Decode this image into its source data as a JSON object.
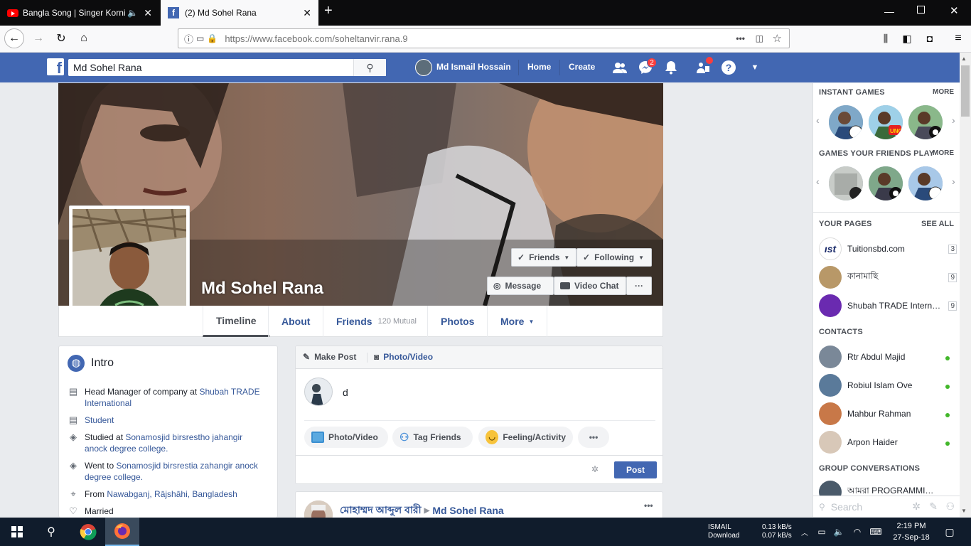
{
  "browser": {
    "tabs": [
      {
        "title": "Bangla Song | Singer Kornia"
      },
      {
        "title": "(2) Md Sohel Rana"
      }
    ],
    "url": "https://www.facebook.com/soheltanvir.rana.9",
    "url_host": "facebook.com"
  },
  "fb": {
    "search_value": "Md Sohel Rana",
    "user_name": "Md Ismail Hossain",
    "nav_home": "Home",
    "nav_create": "Create",
    "messenger_badge": "2"
  },
  "profile": {
    "name": "Md Sohel Rana",
    "btn_friends": "Friends",
    "btn_following": "Following",
    "btn_message": "Message",
    "btn_video_chat": "Video Chat",
    "btn_more": "···",
    "tabs": {
      "timeline": "Timeline",
      "about": "About",
      "friends": "Friends",
      "friends_mutual": "120 Mutual",
      "photos": "Photos",
      "more": "More"
    }
  },
  "intro": {
    "title": "Intro",
    "rows": [
      {
        "pre": "Head Manager of company at ",
        "link": "Shubah TRADE International",
        "post": ""
      },
      {
        "pre": "",
        "link": "Student",
        "post": ""
      },
      {
        "pre": "Studied at ",
        "link": "Sonamosjid birsrestho jahangir anock degree college.",
        "post": ""
      },
      {
        "pre": "Went to ",
        "link": "Sonamosjid birsrestia zahangir anock degree college.",
        "post": ""
      },
      {
        "pre": "From ",
        "link": "Nawabganj, Rājshāhi, Bangladesh",
        "post": ""
      },
      {
        "pre": "Married",
        "link": "",
        "post": ""
      }
    ]
  },
  "composer": {
    "make_post": "Make Post",
    "photo_video_tab": "Photo/Video",
    "text": "d",
    "photo_video": "Photo/Video",
    "tag_friends": "Tag Friends",
    "feeling": "Feeling/Activity",
    "more": "•••",
    "post": "Post"
  },
  "feed_post": {
    "author": "মোহাম্মদ আব্দুল বারী",
    "target": "Md Sohel Rana",
    "menu": "•••"
  },
  "sidebar": {
    "instant_games": "INSTANT GAMES",
    "instant_more": "MORE",
    "friends_games": "GAMES YOUR FRIENDS PLAY",
    "friends_more": "MORE",
    "your_pages": "YOUR PAGES",
    "see_all": "SEE ALL",
    "pages": [
      {
        "name": "Tuitionsbd.com",
        "count": "3"
      },
      {
        "name": "কানামাছি",
        "count": "9"
      },
      {
        "name": "Shubah TRADE Intern…",
        "count": "9"
      }
    ],
    "contacts_title": "CONTACTS",
    "contacts": [
      {
        "name": "Rtr Abdul Majid"
      },
      {
        "name": "Robiul Islam Ove"
      },
      {
        "name": "Mahbur Rahman"
      },
      {
        "name": "Arpon Haider"
      }
    ],
    "group_conv": "GROUP CONVERSATIONS",
    "group_name": "আমরা PROGRAMMI…",
    "search_placeholder": "Search"
  },
  "taskbar": {
    "net_label1": "ISMAIL",
    "net_label2": "Download",
    "up_rate": "0.13 kB/s",
    "down_rate": "0.07 kB/s",
    "time": "2:19 PM",
    "date": "27-Sep-18"
  },
  "colors": {
    "fb_blue": "#4267b2",
    "link": "#365899",
    "online": "#42b72a"
  }
}
